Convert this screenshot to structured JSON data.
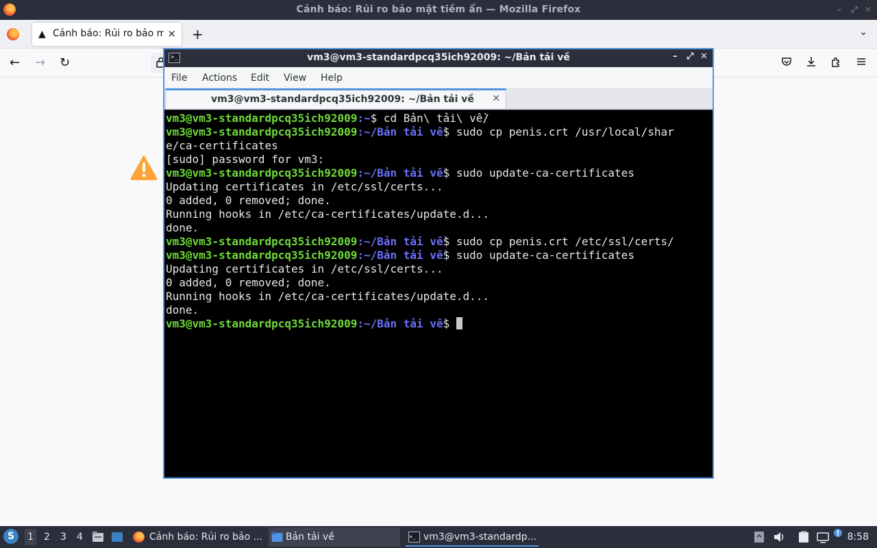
{
  "firefox": {
    "window_title": "Cảnh báo: Rủi ro bảo mật tiềm ẩn — Mozilla Firefox",
    "tab": {
      "label": "Cảnh báo: Rủi ro bảo mật",
      "close": "×"
    },
    "new_tab": "+",
    "list_all_tabs": "⌄",
    "nav": {
      "back": "←",
      "forward": "→",
      "reload": "↻",
      "lock": "🔒"
    },
    "toolbar": {
      "pocket": "♡",
      "downloads": "⤓",
      "extensions": "⇪",
      "menu": "≡"
    }
  },
  "terminal": {
    "window_title": "vm3@vm3-standardpcq35ich92009: ~/Bản tải về",
    "icon_glyph": ">_",
    "controls": {
      "minimize": "–",
      "maximize": "⤢",
      "close": "✕"
    },
    "menu": [
      "File",
      "Actions",
      "Edit",
      "View",
      "Help"
    ],
    "tab": {
      "label": "vm3@vm3-standardpcq35ich92009: ~/Bản tải về",
      "close": "✕"
    },
    "lines": [
      {
        "user": "vm3@vm3-standardpcq35ich92009",
        "path": ":~",
        "cmd": "$ cd Bản\\ tải\\ về/"
      },
      {
        "user": "vm3@vm3-standardpcq35ich92009",
        "path": ":~/Bản tải về",
        "cmd": "$ sudo cp penis.crt /usr/local/shar"
      },
      {
        "text": "e/ca-certificates"
      },
      {
        "text": "[sudo] password for vm3:"
      },
      {
        "user": "vm3@vm3-standardpcq35ich92009",
        "path": ":~/Bản tải về",
        "cmd": "$ sudo update-ca-certificates"
      },
      {
        "text": "Updating certificates in /etc/ssl/certs..."
      },
      {
        "text": "0 added, 0 removed; done."
      },
      {
        "text": "Running hooks in /etc/ca-certificates/update.d..."
      },
      {
        "text": "done."
      },
      {
        "user": "vm3@vm3-standardpcq35ich92009",
        "path": ":~/Bản tải về",
        "cmd": "$ sudo cp penis.crt /etc/ssl/certs/"
      },
      {
        "user": "vm3@vm3-standardpcq35ich92009",
        "path": ":~/Bản tải về",
        "cmd": "$ sudo update-ca-certificates"
      },
      {
        "text": "Updating certificates in /etc/ssl/certs..."
      },
      {
        "text": "0 added, 0 removed; done."
      },
      {
        "text": "Running hooks in /etc/ca-certificates/update.d..."
      },
      {
        "text": "done."
      },
      {
        "user": "vm3@vm3-standardpcq35ich92009",
        "path": ":~/Bản tải về",
        "cmd": "$ ",
        "cursor": true
      }
    ]
  },
  "taskbar": {
    "workspaces": [
      "1",
      "2",
      "3",
      "4"
    ],
    "active_workspace": "1",
    "tasks": [
      {
        "label": "Cảnh báo: Rủi ro bảo ...",
        "icon": "firefox-icon"
      },
      {
        "label": "Bản tải về",
        "icon": "folder-icon"
      },
      {
        "label": "vm3@vm3-standardp...",
        "icon": "terminal-icon"
      }
    ],
    "clock": "8:58"
  },
  "colors": {
    "accent": "#5294e2",
    "prompt_user": "#6fdb3a",
    "prompt_path": "#6b6ffb",
    "panel": "#2b2e3b"
  }
}
